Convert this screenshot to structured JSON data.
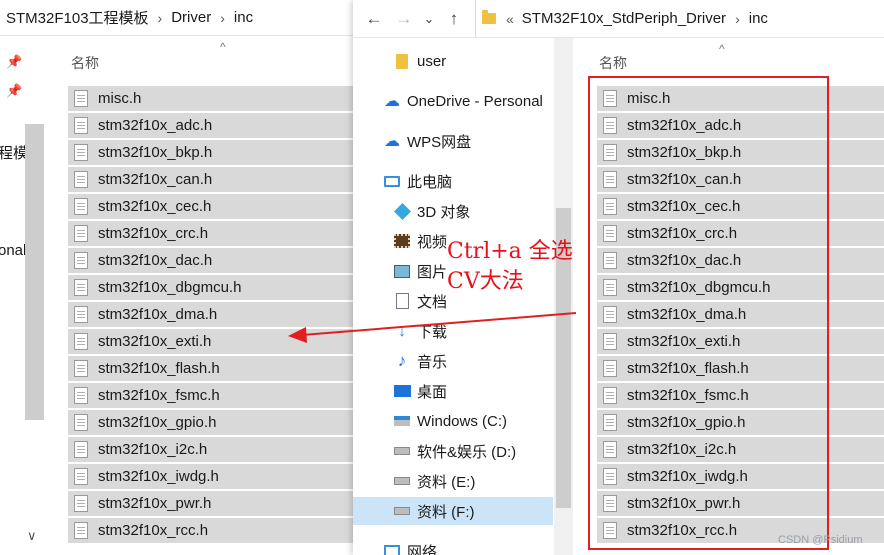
{
  "left_window": {
    "breadcrumb": [
      "STM32F103工程模板",
      "Driver",
      "inc"
    ],
    "nav_fragments": [
      "程模",
      "onal"
    ],
    "column_header": "名称",
    "files": [
      "misc.h",
      "stm32f10x_adc.h",
      "stm32f10x_bkp.h",
      "stm32f10x_can.h",
      "stm32f10x_cec.h",
      "stm32f10x_crc.h",
      "stm32f10x_dac.h",
      "stm32f10x_dbgmcu.h",
      "stm32f10x_dma.h",
      "stm32f10x_exti.h",
      "stm32f10x_flash.h",
      "stm32f10x_fsmc.h",
      "stm32f10x_gpio.h",
      "stm32f10x_i2c.h",
      "stm32f10x_iwdg.h",
      "stm32f10x_pwr.h",
      "stm32f10x_rcc.h"
    ]
  },
  "right_window": {
    "toolbar": {
      "back": "←",
      "forward": "→",
      "dropdown": "⌄",
      "up": "↑"
    },
    "breadcrumb": [
      "«",
      "STM32F10x_StdPeriph_Driver",
      "inc"
    ],
    "nav_items": [
      {
        "label": "user",
        "icon": "folder-icon"
      },
      {
        "label": "OneDrive - Personal",
        "icon": "cloud-icon"
      },
      {
        "label": "WPS网盘",
        "icon": "cloud-icon"
      },
      {
        "label": "此电脑",
        "icon": "computer-icon"
      },
      {
        "label": "3D 对象",
        "icon": "cube-icon"
      },
      {
        "label": "视频",
        "icon": "film-icon"
      },
      {
        "label": "图片",
        "icon": "picture-icon"
      },
      {
        "label": "文档",
        "icon": "document-icon"
      },
      {
        "label": "下载",
        "icon": "download-icon"
      },
      {
        "label": "音乐",
        "icon": "music-icon"
      },
      {
        "label": "桌面",
        "icon": "desktop-icon"
      },
      {
        "label": "Windows (C:)",
        "icon": "windows-drive-icon"
      },
      {
        "label": "软件&娱乐 (D:)",
        "icon": "drive-icon"
      },
      {
        "label": "资料 (E:)",
        "icon": "drive-icon"
      },
      {
        "label": "资料 (F:)",
        "icon": "drive-icon",
        "selected": true
      },
      {
        "label": "网络",
        "icon": "network-icon"
      }
    ],
    "column_header": "名称",
    "files": [
      "misc.h",
      "stm32f10x_adc.h",
      "stm32f10x_bkp.h",
      "stm32f10x_can.h",
      "stm32f10x_cec.h",
      "stm32f10x_crc.h",
      "stm32f10x_dac.h",
      "stm32f10x_dbgmcu.h",
      "stm32f10x_dma.h",
      "stm32f10x_exti.h",
      "stm32f10x_flash.h",
      "stm32f10x_fsmc.h",
      "stm32f10x_gpio.h",
      "stm32f10x_i2c.h",
      "stm32f10x_iwdg.h",
      "stm32f10x_pwr.h",
      "stm32f10x_rcc.h"
    ]
  },
  "annotation": {
    "line1": "Ctrl+a 全选",
    "line2": "CV大法",
    "color": "#e8101a"
  },
  "watermark": "CSDN @Psidium"
}
